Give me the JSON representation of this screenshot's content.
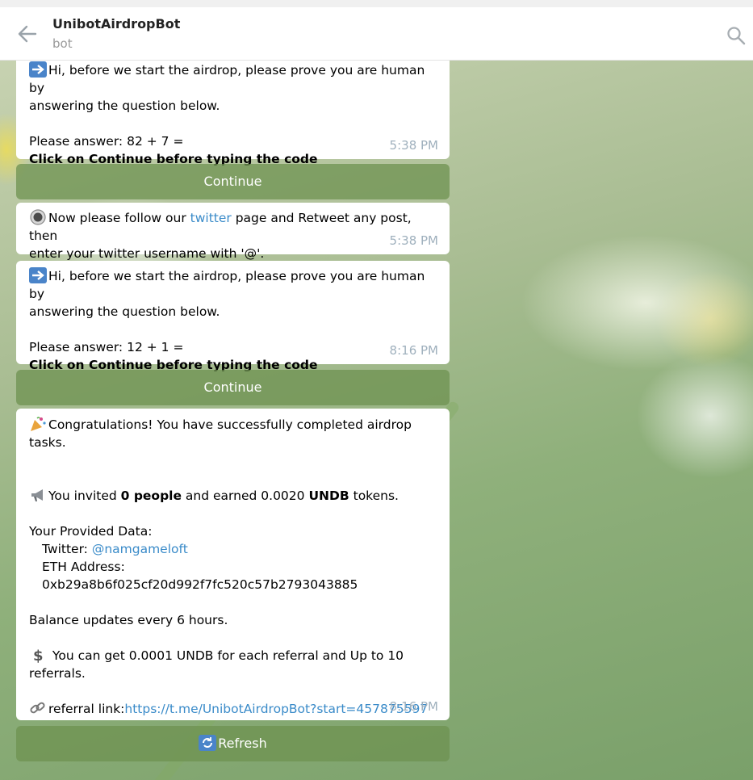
{
  "header": {
    "title": "UnibotAirdropBot",
    "subtitle": "bot"
  },
  "messages": {
    "m1": {
      "line1": "Hi, before we start the airdrop, please prove you are human by",
      "line2": "answering the question below.",
      "question": "Please answer: 82 + 7 =",
      "instruction": "Click on Continue before typing the code",
      "time": "5:38 PM"
    },
    "btn1": "Continue",
    "m2": {
      "prefix": "Now please follow our ",
      "link": "twitter",
      "suffix": " page and Retweet any post, then",
      "line2": "enter your twitter username with '@'.",
      "time": "5:38 PM"
    },
    "m3": {
      "line1": "Hi, before we start the airdrop, please prove you are human by",
      "line2": "answering the question below.",
      "question": "Please answer: 12 + 1 =",
      "instruction": "Click on Continue before typing the code",
      "time": "8:16 PM"
    },
    "btn2": "Continue",
    "m4": {
      "congrats1": "Congratulations! You have successfully completed airdrop",
      "congrats2": "tasks.",
      "invited_a": "You invited ",
      "invited_b": "0 people",
      "invited_c": " and earned 0.0020 ",
      "invited_d": "UNDB",
      "invited_e": " tokens.",
      "provided": "Your Provided Data:",
      "twitter_label": "Twitter: ",
      "twitter_handle": "@namgameloft",
      "eth": "ETH Address: 0xb29a8b6f025cf20d992f7fc520c57b2793043885",
      "balance": "Balance updates every 6 hours.",
      "referral1": " You can get 0.0001 UNDB for each referral  and Up to 10",
      "referral2": "referrals.",
      "link_label": "referral link:",
      "link_url": "https://t.me/UnibotAirdropBot?start=457875597",
      "time": "8:16 PM"
    },
    "btn3": "Refresh"
  },
  "icons": {
    "back": "arrow-left-icon",
    "search": "search-icon",
    "arrow_right": "right-arrow-emoji",
    "radio": "radio-button-emoji",
    "party": "party-popper-emoji",
    "megaphone": "loudspeaker-emoji",
    "dollar": "dollar-sign-emoji",
    "link": "link-emoji",
    "refresh": "refresh-emoji"
  },
  "colors": {
    "accent": "#3a8bc9",
    "button": "#6e9150",
    "timestamp": "#9fb0bd"
  }
}
